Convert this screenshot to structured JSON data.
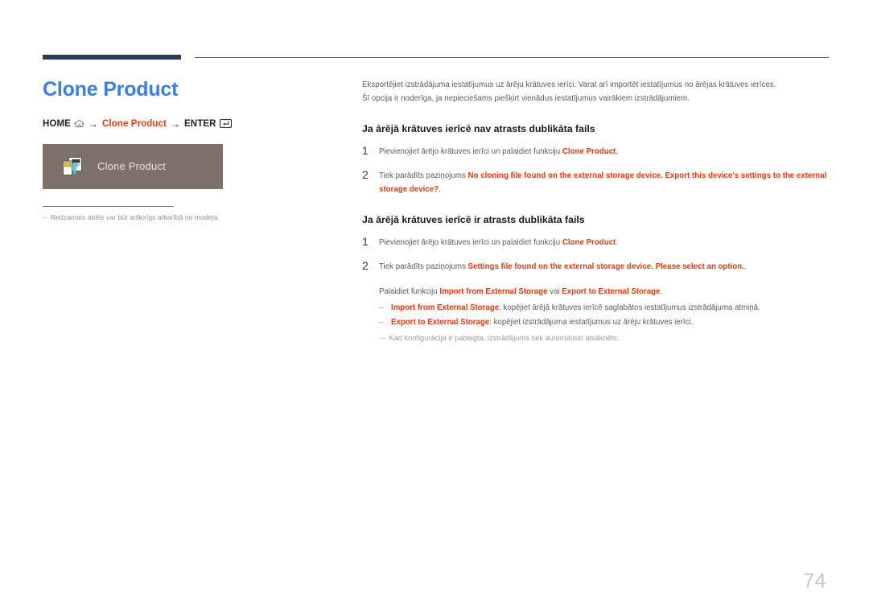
{
  "document": {
    "page_number": "74",
    "title": "Clone Product"
  },
  "header": {
    "accent_color": "#2e3a5c",
    "rule_color": "#56566e"
  },
  "left": {
    "title": "Clone Product",
    "breadcrumb": {
      "home_label": "HOME",
      "home_icon": "home-icon",
      "arrow1": "→",
      "middle_label": "Clone Product",
      "arrow2": "→",
      "enter_label": "ENTER",
      "enter_icon": "enter-key-icon",
      "accent_color": "#dd3c14"
    },
    "thumbnail": {
      "label": "Clone Product",
      "icon": "clone-product-icon",
      "background_color": "#7e716b",
      "label_color": "#e9e4e0"
    },
    "note": {
      "dash": "–",
      "text": "Redzamais attēls var būt atšķirīgs atkarībā no modeļa."
    }
  },
  "main": {
    "intro": [
      "Eksportējiet izstrādājuma iestatījumus uz ārēju krātuves ierīci. Varat arī importēt iestatījumus no ārējas krātuves ierīces.",
      "Šī opcija ir noderīga, ja nepieciešams piešķirt vienādus iestatījumus vairākiem izstrādājumiem."
    ],
    "section1": {
      "heading": "Ja ārējā krātuves ierīcē nav atrasts dublikāta fails",
      "steps": [
        {
          "num": "1",
          "text_before": "Pievienojiet ārējo krātuves ierīci un palaidiet funkciju ",
          "emphasis": "Clone Product",
          "text_after": "."
        },
        {
          "num": "2",
          "text_before": "Tiek parādīts paziņojums ",
          "emphasis": "No cloning file found on the external storage device. Export this device's settings to the external storage device?",
          "text_after": "."
        }
      ]
    },
    "section2": {
      "heading": "Ja ārējā krātuves ierīcē ir atrasts dublikāta fails",
      "steps": [
        {
          "num": "1",
          "text_before": "Pievienojiet ārējo krātuves ierīci un palaidiet funkciju ",
          "emphasis": "Clone Product",
          "text_after": "."
        },
        {
          "num": "2",
          "text_before": "Tiek parādīts paziņojums ",
          "emphasis": "Settings file found on the external storage device. Please select an option.",
          "text_after": "."
        }
      ],
      "sub_line": {
        "text_before": "Palaidiet funkciju ",
        "emphasis1": "Import from External Storage",
        "text_middle": " vai ",
        "emphasis2": "Export to External Storage",
        "text_after": "."
      },
      "bullets": [
        {
          "dash": "–",
          "emphasis": "Import from External Storage",
          "text": ": kopējiet ārējā krātuves ierīcē saglabātos iestatījumus izstrādājuma atmiņā."
        },
        {
          "dash": "–",
          "emphasis": "Export to External Storage",
          "text": ": kopējiet izstrādājuma iestatījumus uz ārēju krātuves ierīci."
        }
      ],
      "footnote": {
        "dash": "—",
        "text": "Kad konfigurācija ir pabeigta, izstrādājums tiek automātiski atsāknēts."
      }
    }
  }
}
